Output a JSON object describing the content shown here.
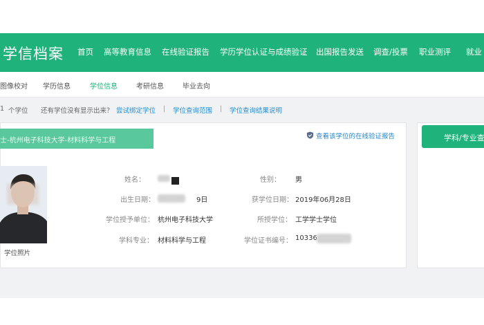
{
  "app": {
    "logo": "学信档案"
  },
  "nav": [
    {
      "label": "首页"
    },
    {
      "label": "高等教育信息",
      "active": true
    },
    {
      "label": "在线验证报告"
    },
    {
      "label": "学历学位认证与成绩验证"
    },
    {
      "label": "出国报告发送"
    },
    {
      "label": "调查/投票"
    },
    {
      "label": "职业测评"
    },
    {
      "label": "就业"
    }
  ],
  "subnav": [
    {
      "label": "图像校对"
    },
    {
      "label": "学历信息"
    },
    {
      "label": "学位信息",
      "active": true
    },
    {
      "label": "考研信息"
    },
    {
      "label": "毕业去向"
    }
  ],
  "crumbs": {
    "count_prefix": "1",
    "count_label": "个学位",
    "question": "还有学位没有显示出来？",
    "bind_link": "尝试绑定学位",
    "sep": "|",
    "scope_link": "学位查询范围",
    "result_link": "学位查询结果说明"
  },
  "degree": {
    "banner": "士-杭州电子科技大学-材料科学与工程",
    "verify_link": "查看该学位的在线验证报告",
    "photo_caption": "学位照片",
    "fields": {
      "name_label": "姓名：",
      "gender_label": "性别：",
      "gender_value": "男",
      "dob_label": "出生日期：",
      "dob_suffix": "9日",
      "award_date_label": "获学位日期：",
      "award_date_value": "2019年06月28日",
      "institution_label": "学位授予单位：",
      "institution_value": "杭州电子科技大学",
      "degree_label": "所授学位：",
      "degree_value": "工学学士学位",
      "major_label": "学科专业：",
      "major_value": "材料科学与工程",
      "cert_label": "学位证书编号：",
      "cert_prefix": "10336"
    }
  },
  "side": {
    "major_button": "学科/专业查"
  },
  "colors": {
    "brand": "#1fb27a",
    "banner": "#59c89c",
    "link": "#1f8fd6"
  }
}
